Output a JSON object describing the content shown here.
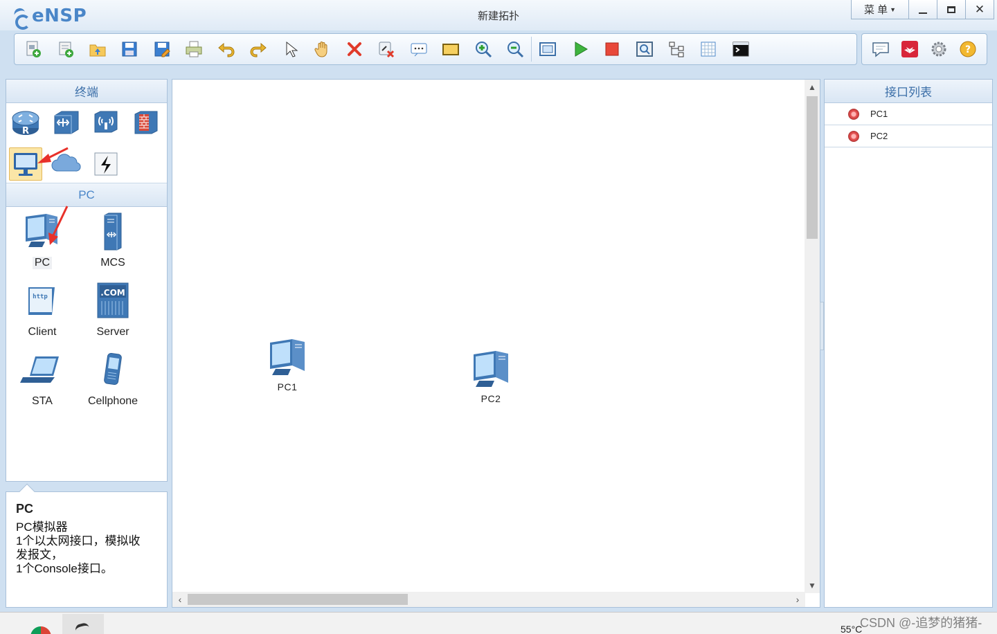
{
  "app": {
    "logo_text": "eNSP",
    "window_title": "新建拓扑",
    "menu_label": "菜 单"
  },
  "toolbar": {
    "buttons": [
      "new-topology-icon",
      "new-lab-icon",
      "open-icon",
      "save-icon",
      "save-as-icon",
      "print-icon",
      "undo-icon",
      "redo-icon",
      "select-pointer-icon",
      "pan-hand-icon",
      "delete-icon",
      "delete-connection-icon",
      "text-label-icon",
      "rectangle-icon",
      "zoom-in-icon",
      "zoom-out-icon",
      "fit-view-icon",
      "start-device-icon",
      "stop-device-icon",
      "capture-icon",
      "topology-icon",
      "grid-icon",
      "console-icon"
    ],
    "right_buttons": [
      "chat-icon",
      "huawei-icon",
      "settings-gear-icon",
      "help-icon"
    ]
  },
  "left_panel": {
    "header": "终端",
    "categories": [
      "router-icon",
      "switch-icon",
      "wlan-icon",
      "firewall-icon",
      "terminal-pc-icon",
      "cloud-icon",
      "connection-icon"
    ],
    "sub_header": "PC",
    "devices": [
      {
        "name": "pc",
        "label": "PC"
      },
      {
        "name": "mcs",
        "label": "MCS"
      },
      {
        "name": "client",
        "label": "Client"
      },
      {
        "name": "server",
        "label": "Server"
      },
      {
        "name": "sta",
        "label": "STA"
      },
      {
        "name": "cellphone",
        "label": "Cellphone"
      }
    ]
  },
  "description": {
    "title": "PC",
    "lines": [
      "PC模拟器",
      "1个以太网接口，模拟收",
      "发报文，",
      "1个Console接口。"
    ]
  },
  "canvas": {
    "nodes": [
      {
        "label": "PC1"
      },
      {
        "label": "PC2"
      }
    ]
  },
  "right_panel": {
    "header": "接口列表",
    "interfaces": [
      {
        "label": "PC1",
        "status": "stopped",
        "color": "#e05050"
      },
      {
        "label": "PC2",
        "status": "stopped",
        "color": "#e05050"
      }
    ]
  },
  "taskbar": {
    "temperature": "55°C",
    "watermark": "CSDN @-追梦的猪猪-"
  },
  "colors": {
    "accent": "#4a86c8",
    "panel_border": "#a9c1da",
    "selected_bg": "#fbe6a7",
    "annotation_red": "#e8312a"
  }
}
